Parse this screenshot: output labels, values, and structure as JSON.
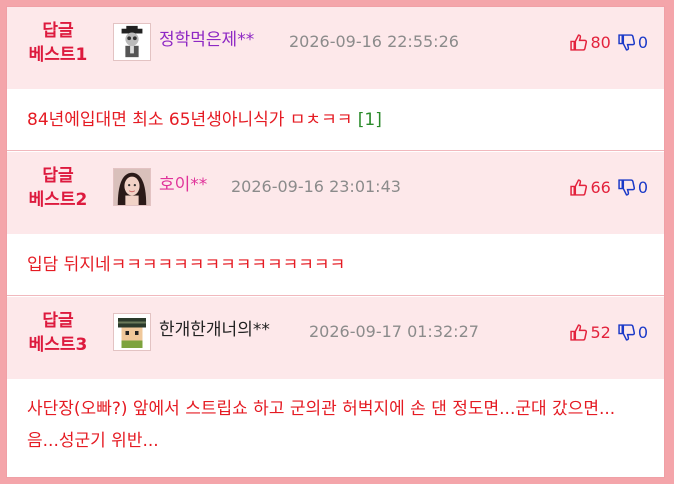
{
  "comments": [
    {
      "best_line1": "답글",
      "best_line2": "베스트1",
      "nickname": "정학먹은제**",
      "nick_color": "#8e28c4",
      "avatar_icon": "professor-avatar-icon",
      "date": "2026-09-16 22:55:26",
      "up": "80",
      "down": "0",
      "text": "84년에입대면 최소 65년생아니식가 ㅁㅊㅋㅋ",
      "reply_count": "[1]"
    },
    {
      "best_line1": "답글",
      "best_line2": "베스트2",
      "nickname": "호이**",
      "nick_color": "#e0329a",
      "avatar_icon": "woman-photo-avatar-icon",
      "date": "2026-09-16 23:01:43",
      "up": "66",
      "down": "0",
      "text": "입담 뒤지네ㅋㅋㅋㅋㅋㅋㅋㅋㅋㅋㅋㅋㅋㅋㅋ",
      "reply_count": ""
    },
    {
      "best_line1": "답글",
      "best_line2": "베스트3",
      "nickname": "한개한개너의**",
      "nick_color": "#222222",
      "avatar_icon": "pixel-soldier-avatar-icon",
      "date": "2026-09-17 01:32:27",
      "up": "52",
      "down": "0",
      "text": "사단장(오빠?) 앞에서 스트립쇼 하고 군의관 허벅지에 손 댄 정도면...군대 갔으면...음...성군기 위반...",
      "reply_count": ""
    }
  ],
  "colors": {
    "header_bg": "#fde8ea",
    "frame_border": "#f4a5aa",
    "comment_text": "#e51b23",
    "best_label": "#dd1a3e",
    "upvote": "#e3223c",
    "downvote": "#1a39c8"
  }
}
